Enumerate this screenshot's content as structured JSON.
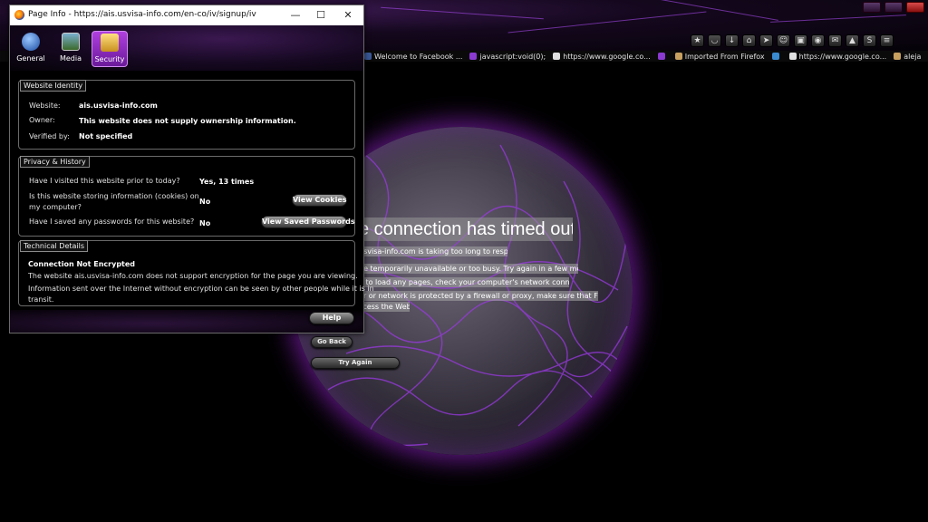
{
  "dialog": {
    "title": "Page Info - https://ais.usvisa-info.com/en-co/iv/signup/iv",
    "tabs": [
      {
        "label": "General",
        "icon": "info-icon"
      },
      {
        "label": "Media",
        "icon": "media-icon"
      },
      {
        "label": "Security",
        "icon": "lock-icon"
      }
    ],
    "active_tab": "Security",
    "identity": {
      "legend": "Website Identity",
      "website_label": "Website:",
      "website_value": "ais.usvisa-info.com",
      "owner_label": "Owner:",
      "owner_value": "This website does not supply ownership information.",
      "verified_label": "Verified by:",
      "verified_value": "Not specified"
    },
    "privacy": {
      "legend": "Privacy & History",
      "visited_q": "Have I visited this website prior to today?",
      "visited_a": "Yes, 13 times",
      "cookies_q1": "Is this website storing information (cookies) on",
      "cookies_q2": "my computer?",
      "cookies_a": "No",
      "cookies_btn": "View Cookies",
      "passwords_q": "Have I saved any passwords for this website?",
      "passwords_a": "No",
      "passwords_btn": "View Saved Passwords"
    },
    "technical": {
      "legend": "Technical Details",
      "heading": "Connection Not Encrypted",
      "line1": "The website ais.usvisa-info.com does not support encryption for the page you are viewing.",
      "line2a": "Information sent over the Internet without encryption can be seen by other people while it is in",
      "line2b": "transit."
    },
    "help_btn": "Help"
  },
  "bookmarks": [
    {
      "label": "Welcome to Facebook ...",
      "color": "#3b5998"
    },
    {
      "label": "javascript:void(0);",
      "color": "#8a3ad0"
    },
    {
      "label": "https://www.google.co...",
      "color": "#e0e0e0"
    },
    {
      "label": "",
      "color": "#8a3ad0"
    },
    {
      "label": "Imported From Firefox",
      "color": "#c8a060"
    },
    {
      "label": "",
      "color": "#3a8ad0"
    },
    {
      "label": "https://www.google.co...",
      "color": "#e0e0e0"
    },
    {
      "label": "aleja",
      "color": "#c8a060"
    }
  ],
  "error_page": {
    "title": "e connection has timed out",
    "lines": [
      "usvisa-info.com is taking too long to respond.",
      "be temporarily unavailable or too busy. Try again in a few moments.",
      "e to load any pages, check your computer's network connection.",
      "er or network is protected by a firewall or proxy, make sure that Firefox is",
      "ccess the Web."
    ],
    "go_back": "Go Back",
    "try_again": "Try Again"
  },
  "toolbar_icons": [
    "bookmark-star-icon",
    "pocket-icon",
    "download-icon",
    "home-icon",
    "send-icon",
    "smiley-icon",
    "addon-icon",
    "chrome-icon",
    "gmail-icon",
    "fire-icon",
    "skype-icon",
    "menu-icon"
  ],
  "colors": {
    "accent_purple": "#a040e0",
    "background": "#000000"
  }
}
